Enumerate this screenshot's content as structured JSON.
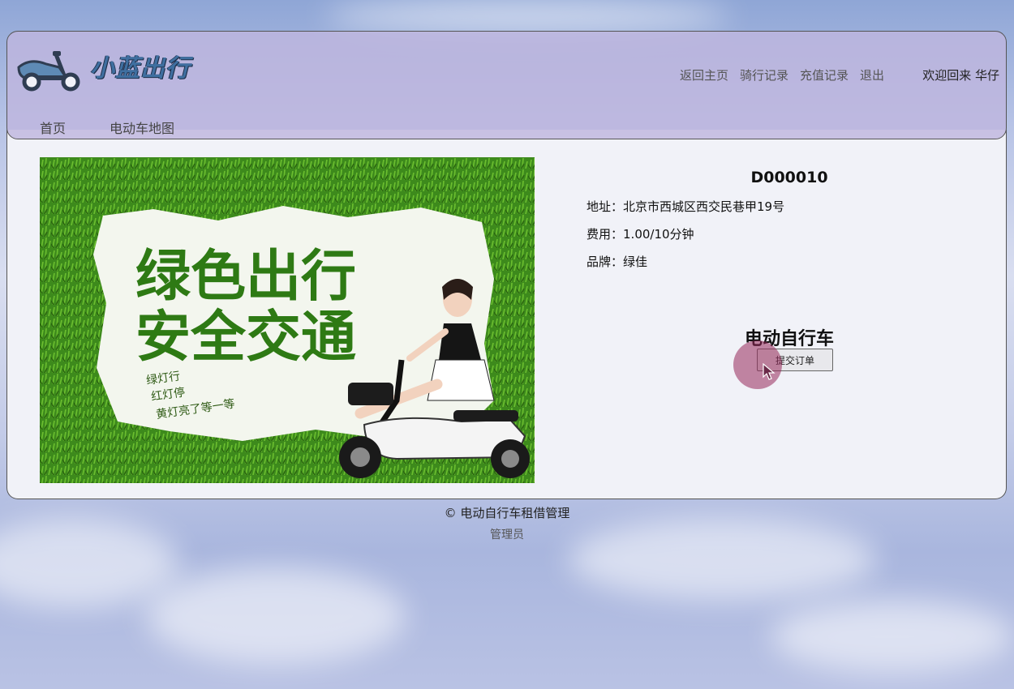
{
  "app": {
    "brand": "小蓝出行"
  },
  "header": {
    "top_nav": [
      "返回主页",
      "骑行记录",
      "充值记录",
      "退出"
    ],
    "welcome": "欢迎回来 华仔",
    "sub_nav": [
      "首页",
      "电动车地图"
    ]
  },
  "banner": {
    "headline_1": "绿色出行",
    "headline_2": "安全交通",
    "slogan_1": "绿灯行",
    "slogan_2": "红灯停",
    "slogan_3": "黄灯亮了等一等"
  },
  "vehicle": {
    "code": "D000010",
    "address_label": "地址：",
    "address": "北京市西城区西交民巷甲19号",
    "fee_label": "费用：",
    "fee": "1.00/10分钟",
    "brand_label": "品牌：",
    "brand": "绿佳",
    "type": "电动自行车",
    "submit_label": "提交订单"
  },
  "footer": {
    "copyright": "© 电动自行车租借管理",
    "admin": "管理员"
  },
  "colors": {
    "header_bg": "#beb6de",
    "brand_blue": "#3f6fa0",
    "grass_green": "#3f8a1e",
    "cursor_highlight": "#962a5a"
  }
}
